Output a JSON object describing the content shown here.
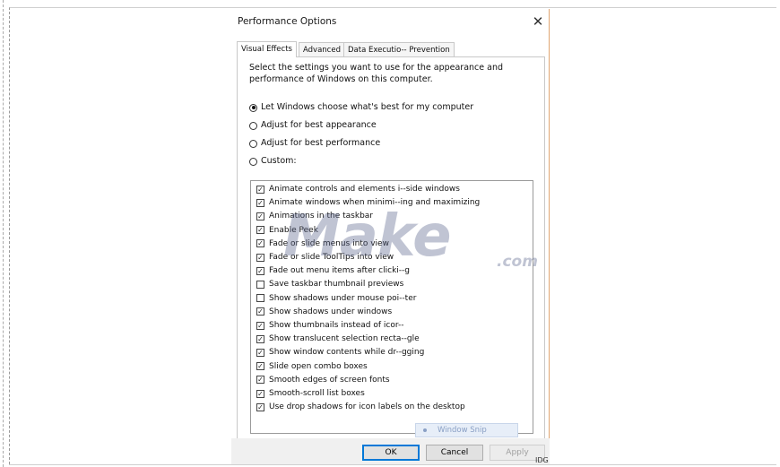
{
  "dialog": {
    "title": "Performance Options",
    "close_glyph": "✕"
  },
  "tabs": [
    {
      "label": "Visual Effects",
      "active": true
    },
    {
      "label": "Advanced",
      "active": false
    },
    {
      "label": "Data Executio-- Prevention",
      "active": false
    }
  ],
  "visual_effects": {
    "description": "Select the settings you want to use for the appearance and performance of Windows on this computer.",
    "radio_options": [
      {
        "label": "Let Windows choose what's best for my computer",
        "selected": true
      },
      {
        "label": "Adjust for best appearance",
        "selected": false
      },
      {
        "label": "Adjust for best performance",
        "selected": false
      },
      {
        "label": "Custom:",
        "selected": false
      }
    ],
    "effects": [
      {
        "label": "Animate controls and elements i--side windows",
        "checked": true
      },
      {
        "label": "Animate windows when minimi--ing and maximizing",
        "checked": true
      },
      {
        "label": "Animations in the taskbar",
        "checked": true
      },
      {
        "label": "Enable Peek",
        "checked": true
      },
      {
        "label": "Fade or slide menus into view",
        "checked": true
      },
      {
        "label": "Fade or slide ToolTips into view",
        "checked": true
      },
      {
        "label": "Fade out menu items after clicki--g",
        "checked": true
      },
      {
        "label": "Save taskbar thumbnail previews",
        "checked": false
      },
      {
        "label": "Show shadows under mouse poi--ter",
        "checked": false
      },
      {
        "label": "Show shadows under windows",
        "checked": true
      },
      {
        "label": "Show thumbnails instead of icor--",
        "checked": true
      },
      {
        "label": "Show translucent selection recta--gle",
        "checked": true
      },
      {
        "label": "Show window contents while dr--gging",
        "checked": true
      },
      {
        "label": "Slide open combo boxes",
        "checked": true
      },
      {
        "label": "Smooth edges of screen fonts",
        "checked": true
      },
      {
        "label": "Smooth-scroll list boxes",
        "checked": true
      },
      {
        "label": "Use drop shadows for icon labels on the desktop",
        "checked": true
      }
    ]
  },
  "footer": {
    "ok_label": "OK",
    "cancel_label": "Cancel",
    "apply_label": "Apply"
  },
  "popup": {
    "label": "Window Snip"
  },
  "watermark": {
    "text": "Make",
    "suffix": ".com"
  },
  "credit": "IDG",
  "colors": {
    "accent_border": "#e0a672",
    "ok_focus": "#0078d7",
    "footer_bg": "#f0f0f0"
  }
}
